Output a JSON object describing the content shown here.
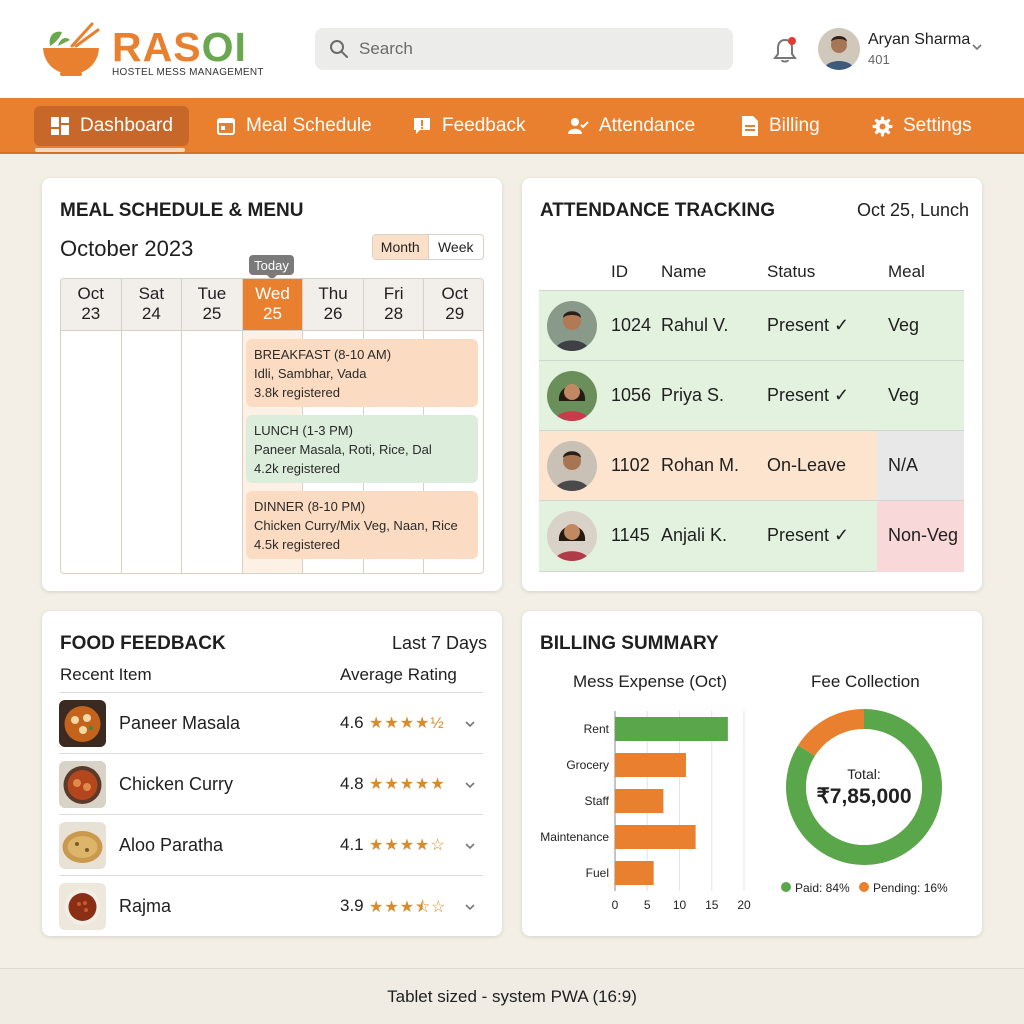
{
  "app": {
    "name_part1": "RAS",
    "name_part2": "OI",
    "subtitle": "HOSTEL MESS MANAGEMENT"
  },
  "search": {
    "placeholder": "Search"
  },
  "user": {
    "name": "Aryan Sharma",
    "room": "401"
  },
  "nav": [
    {
      "label": "Dashboard",
      "icon": "dashboard-icon",
      "active": true
    },
    {
      "label": "Meal Schedule",
      "icon": "calendar-icon"
    },
    {
      "label": "Feedback",
      "icon": "feedback-icon"
    },
    {
      "label": "Attendance",
      "icon": "person-check-icon"
    },
    {
      "label": "Billing",
      "icon": "document-icon"
    },
    {
      "label": "Settings",
      "icon": "gear-icon"
    }
  ],
  "meal_schedule": {
    "title": "MEAL SCHEDULE & MENU",
    "month": "October 2023",
    "view_month": "Month",
    "view_week": "Week",
    "today_label": "Today",
    "days": [
      {
        "dow": "Oct",
        "date": "23"
      },
      {
        "dow": "Sat",
        "date": "24"
      },
      {
        "dow": "Tue",
        "date": "25"
      },
      {
        "dow": "Wed",
        "date": "25",
        "today": true
      },
      {
        "dow": "Thu",
        "date": "26"
      },
      {
        "dow": "Fri",
        "date": "28"
      },
      {
        "dow": "Oct",
        "date": "29"
      }
    ],
    "meals": [
      {
        "name": "BREAKFAST (8-10 AM)",
        "menu": "Idli, Sambhar, Vada",
        "registered": "3.8k registered",
        "color": "#fbdcc3"
      },
      {
        "name": "LUNCH (1-3 PM)",
        "menu": "Paneer Masala, Roti, Rice, Dal",
        "registered": "4.2k registered",
        "color": "#dceedb"
      },
      {
        "name": "DINNER (8-10 PM)",
        "menu": "Chicken Curry/Mix Veg, Naan, Rice",
        "registered": "4.5k registered",
        "color": "#fbdcc3"
      }
    ]
  },
  "attendance": {
    "title": "ATTENDANCE TRACKING",
    "context": "Oct 25, Lunch",
    "columns": [
      "ID",
      "Name",
      "Status",
      "Meal"
    ],
    "rows": [
      {
        "id": "1024",
        "name": "Rahul V.",
        "status": "Present ✓",
        "meal": "Veg"
      },
      {
        "id": "1056",
        "name": "Priya S.",
        "status": "Present ✓",
        "meal": "Veg"
      },
      {
        "id": "1102",
        "name": "Rohan M.",
        "status": "On-Leave",
        "meal": "N/A"
      },
      {
        "id": "1145",
        "name": "Anjali K.",
        "status": "Present ✓",
        "meal": "Non-Veg"
      }
    ]
  },
  "feedback": {
    "title": "FOOD FEEDBACK",
    "period": "Last 7 Days",
    "col_item": "Recent Item",
    "col_rating": "Average Rating",
    "items": [
      {
        "name": "Paneer Masala",
        "rating": "4.6",
        "stars": "★★★★½"
      },
      {
        "name": "Chicken Curry",
        "rating": "4.8",
        "stars": "★★★★★"
      },
      {
        "name": "Aloo Paratha",
        "rating": "4.1",
        "stars": "★★★★☆"
      },
      {
        "name": "Rajma",
        "rating": "3.9",
        "stars": "★★★⯪☆"
      }
    ]
  },
  "billing": {
    "title": "BILLING SUMMARY",
    "footer_note": "Tablet sized - system PWA (16:9)"
  },
  "chart_data": [
    {
      "type": "bar",
      "orientation": "horizontal",
      "title": "Mess Expense (Oct)",
      "categories": [
        "Rent",
        "Grocery",
        "Staff",
        "Maintenance",
        "Fuel"
      ],
      "values": [
        17.5,
        11,
        7.5,
        12.5,
        6
      ],
      "colors": [
        "#5aa64a",
        "#e9802f",
        "#e9802f",
        "#e9802f",
        "#e9802f"
      ],
      "xlim": [
        0,
        20
      ],
      "xticks": [
        "0",
        "5",
        "10",
        "15",
        "20"
      ]
    },
    {
      "type": "pie",
      "title": "Fee Collection",
      "center_label": "Total:",
      "center_value": "₹7,85,000",
      "slices": [
        {
          "label": "Paid: 84%",
          "value": 84,
          "color": "#5aa64a"
        },
        {
          "label": "Pending: 16%",
          "value": 16,
          "color": "#e9802f"
        }
      ]
    }
  ]
}
